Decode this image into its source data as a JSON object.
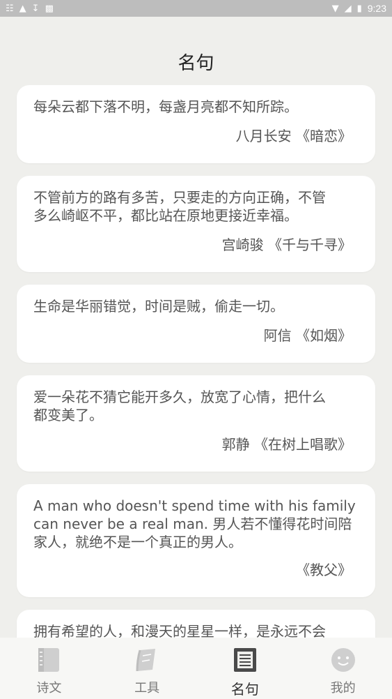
{
  "status_bar": {
    "time": "9:23"
  },
  "header": {
    "title": "名句"
  },
  "quotes": [
    {
      "text": "每朵云都下落不明，每盏月亮都不知所踪。",
      "attribution": "八月长安 《暗恋》"
    },
    {
      "text": "不管前方的路有多苦，只要走的方向正确，不管\n多么崎岖不平，都比站在原地更接近幸福。",
      "attribution": "宫崎骏 《千与千寻》"
    },
    {
      "text": "生命是华丽错觉，时间是贼，偷走一切。",
      "attribution": "阿信 《如烟》"
    },
    {
      "text": "爱一朵花不猜它能开多久，放宽了心情，把什么\n都变美了。",
      "attribution": "郭静 《在树上唱歌》"
    },
    {
      "text": "A man who doesn't spend time with his family\ncan never be a real man. 男人若不懂得花时间陪\n家人，就绝不是一个真正的男人。",
      "attribution": "《教父》"
    },
    {
      "text": "拥有希望的人，和漫天的星星一样，是永远不会",
      "attribution": ""
    }
  ],
  "bottom_nav": {
    "items": [
      {
        "label": "诗文",
        "icon": "book-icon"
      },
      {
        "label": "工具",
        "icon": "scroll-icon"
      },
      {
        "label": "名句",
        "icon": "quote-book-icon"
      },
      {
        "label": "我的",
        "icon": "smiley-icon"
      }
    ],
    "active_index": 2
  },
  "colors": {
    "background": "#efefec",
    "card": "#ffffff",
    "text": "#555555",
    "nav_icon": "#c8c8c8",
    "nav_icon_active": "#4a4a4a"
  }
}
